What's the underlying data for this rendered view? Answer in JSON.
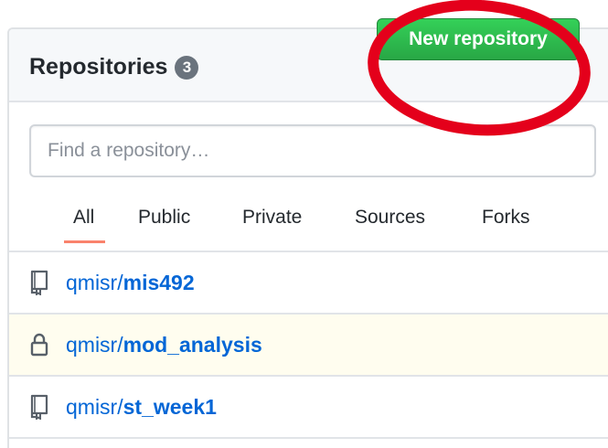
{
  "header": {
    "title": "Repositories",
    "count": "3",
    "new_button_label": "New repository"
  },
  "search": {
    "placeholder": "Find a repository…",
    "value": ""
  },
  "tabs": [
    {
      "label": "All",
      "selected": true
    },
    {
      "label": "Public",
      "selected": false
    },
    {
      "label": "Private",
      "selected": false
    },
    {
      "label": "Sources",
      "selected": false
    },
    {
      "label": "Forks",
      "selected": false
    }
  ],
  "repos": [
    {
      "owner": "qmisr/",
      "name": "mis492",
      "icon": "repo-icon",
      "private": false
    },
    {
      "owner": "qmisr/",
      "name": "mod_analysis",
      "icon": "lock-icon",
      "private": true
    },
    {
      "owner": "qmisr/",
      "name": "st_week1",
      "icon": "repo-icon",
      "private": false
    }
  ],
  "colors": {
    "accent_button": "#2ea44f",
    "link": "#0366d6",
    "annotation_circle": "#e4001b",
    "selected_tab_underline": "#f9826c",
    "private_row_bg": "#fffdef"
  }
}
